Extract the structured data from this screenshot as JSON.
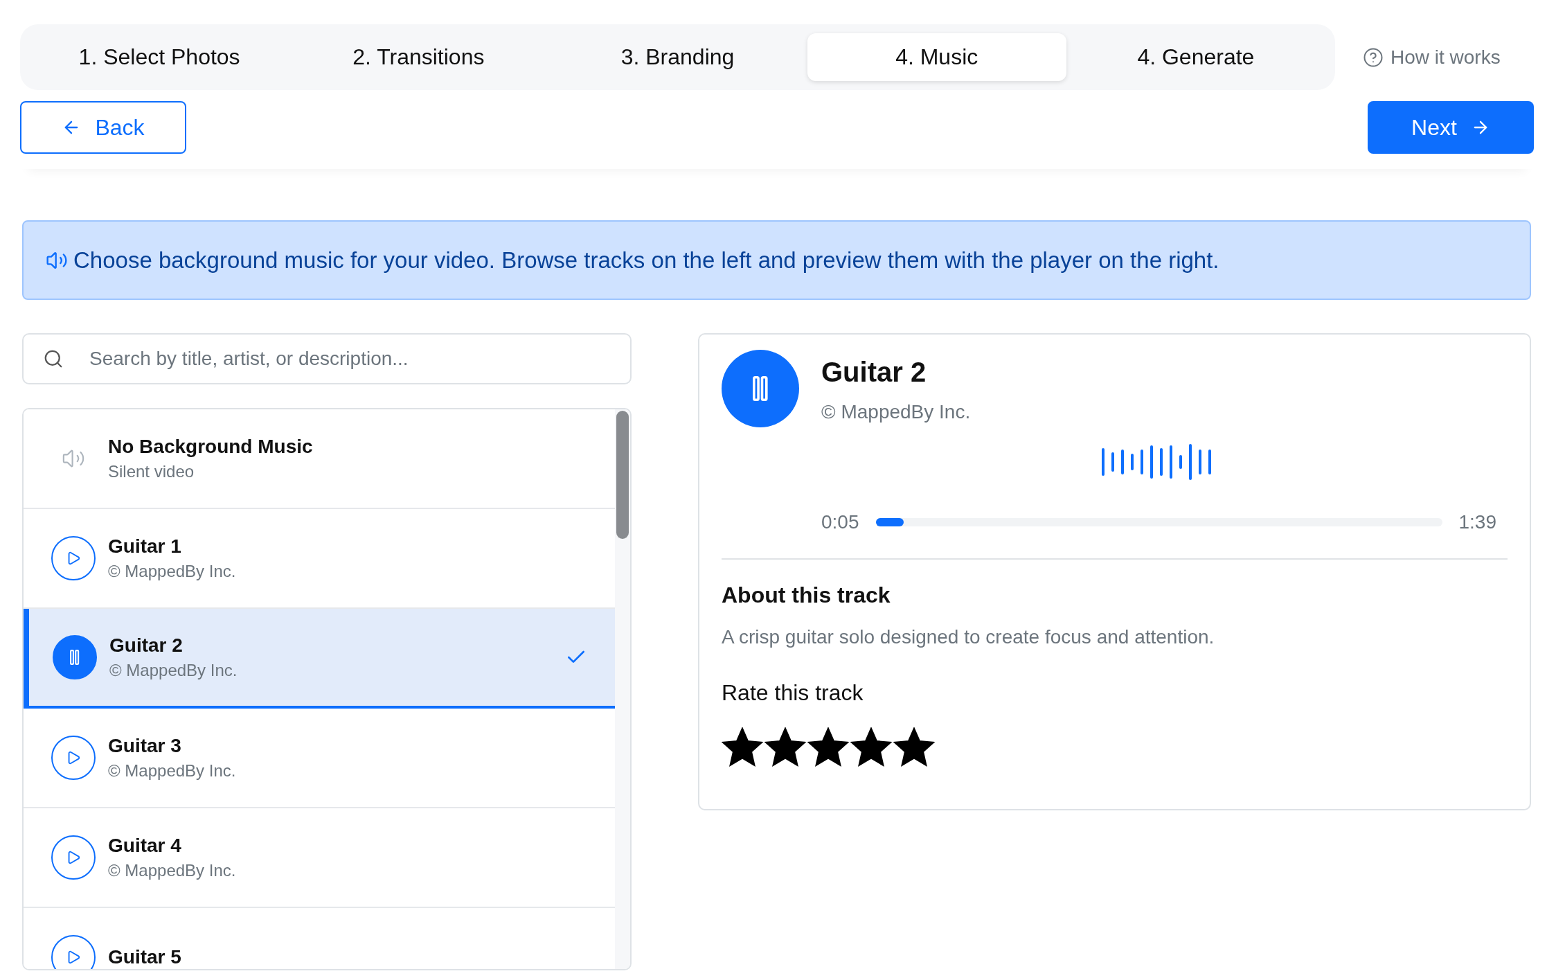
{
  "steps": [
    {
      "label": "1. Select Photos",
      "selected": false
    },
    {
      "label": "2. Transitions",
      "selected": false
    },
    {
      "label": "3. Branding",
      "selected": false
    },
    {
      "label": "4. Music",
      "selected": true
    },
    {
      "label": "4. Generate",
      "selected": false
    }
  ],
  "help_link": "How it works",
  "back_button": "Back",
  "next_button": "Next",
  "info_banner": "Choose background music for your video. Browse tracks on the left and preview them with the player on the right.",
  "search": {
    "placeholder": "Search by title, artist, or description..."
  },
  "tracks": [
    {
      "kind": "none",
      "title": "No Background Music",
      "subtitle": "Silent video",
      "selected": false
    },
    {
      "kind": "track",
      "title": "Guitar 1",
      "subtitle": "© MappedBy Inc.",
      "selected": false
    },
    {
      "kind": "track",
      "title": "Guitar 2",
      "subtitle": "© MappedBy Inc.",
      "selected": true
    },
    {
      "kind": "track",
      "title": "Guitar 3",
      "subtitle": "© MappedBy Inc.",
      "selected": false
    },
    {
      "kind": "track",
      "title": "Guitar 4",
      "subtitle": "© MappedBy Inc.",
      "selected": false
    },
    {
      "kind": "track",
      "title": "Guitar 5",
      "selected": false
    }
  ],
  "player": {
    "playing": true,
    "title": "Guitar 2",
    "subtitle": "© MappedBy Inc.",
    "elapsed": "0:05",
    "duration": "1:39",
    "level": 0.05,
    "about_heading": "About this track",
    "description": "A crisp guitar solo designed to create focus and attention.",
    "rating_label": "Rate this track",
    "stars": 5
  }
}
